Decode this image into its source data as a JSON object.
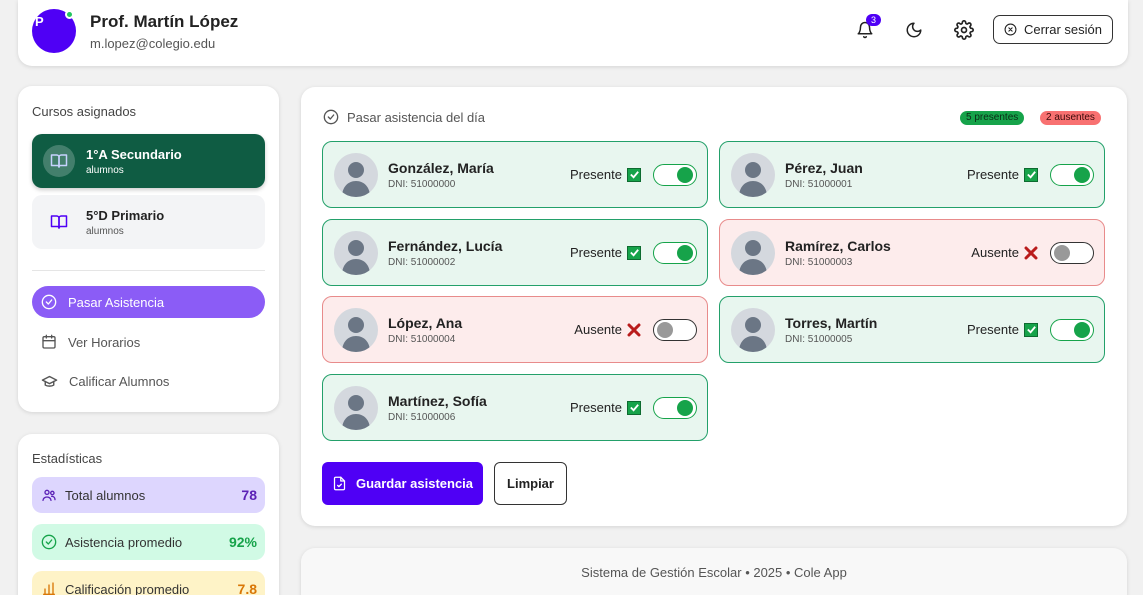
{
  "header": {
    "avatar_initial": "P",
    "name": "Prof. Martín López",
    "email": "m.lopez@colegio.edu",
    "notifications_count": "3",
    "logout_label": "Cerrar sesión",
    "icons": [
      "bell-icon",
      "moon-icon",
      "gear-icon",
      "close-circle-icon"
    ]
  },
  "sidebar": {
    "courses_title": "Cursos asignados",
    "courses": [
      {
        "name": "1°A Secundario",
        "sub": "alumnos",
        "active": true
      },
      {
        "name": "5°D Primario",
        "sub": "alumnos",
        "active": false
      }
    ],
    "nav": [
      {
        "label": "Pasar Asistencia",
        "icon": "check-circle-icon",
        "active": true
      },
      {
        "label": "Ver Horarios",
        "icon": "calendar-icon",
        "active": false
      },
      {
        "label": "Calificar Alumnos",
        "icon": "graduation-cap-icon",
        "active": false
      }
    ]
  },
  "stats": {
    "title": "Estadísticas",
    "items": [
      {
        "label": "Total alumnos",
        "value": "78",
        "icon": "users-icon",
        "color": "#5b21b6",
        "bg": "#ddd6fe"
      },
      {
        "label": "Asistencia promedio",
        "value": "92%",
        "icon": "check-circle-icon",
        "color": "#16a34a",
        "bg": "#d1fae5"
      },
      {
        "label": "Calificación promedio",
        "value": "7.8",
        "icon": "bar-chart-icon",
        "color": "#d97706",
        "bg": "#fef3c7"
      }
    ]
  },
  "attendance": {
    "title": "Pasar asistencia del día",
    "present_badge": "5 presentes",
    "absent_badge": "2 ausentes",
    "students": [
      {
        "name": "González, María",
        "dni": "DNI: 51000000",
        "status": "Presente",
        "present": true
      },
      {
        "name": "Pérez, Juan",
        "dni": "DNI: 51000001",
        "status": "Presente",
        "present": true
      },
      {
        "name": "Fernández, Lucía",
        "dni": "DNI: 51000002",
        "status": "Presente",
        "present": true
      },
      {
        "name": "Ramírez, Carlos",
        "dni": "DNI: 51000003",
        "status": "Ausente",
        "present": false
      },
      {
        "name": "López, Ana",
        "dni": "DNI: 51000004",
        "status": "Ausente",
        "present": false
      },
      {
        "name": "Torres, Martín",
        "dni": "DNI: 51000005",
        "status": "Presente",
        "present": true
      },
      {
        "name": "Martínez, Sofía",
        "dni": "DNI: 51000006",
        "status": "Presente",
        "present": true
      }
    ],
    "save_label": "Guardar asistencia",
    "clear_label": "Limpiar"
  },
  "footer": {
    "text": "Sistema de Gestión Escolar • 2025 • Cole App"
  },
  "colors": {
    "primary": "#4f00f5",
    "course_active": "#0f5c43",
    "nav_active": "#8b5cf6",
    "present": "#16a34a",
    "absent": "#dc2626"
  }
}
